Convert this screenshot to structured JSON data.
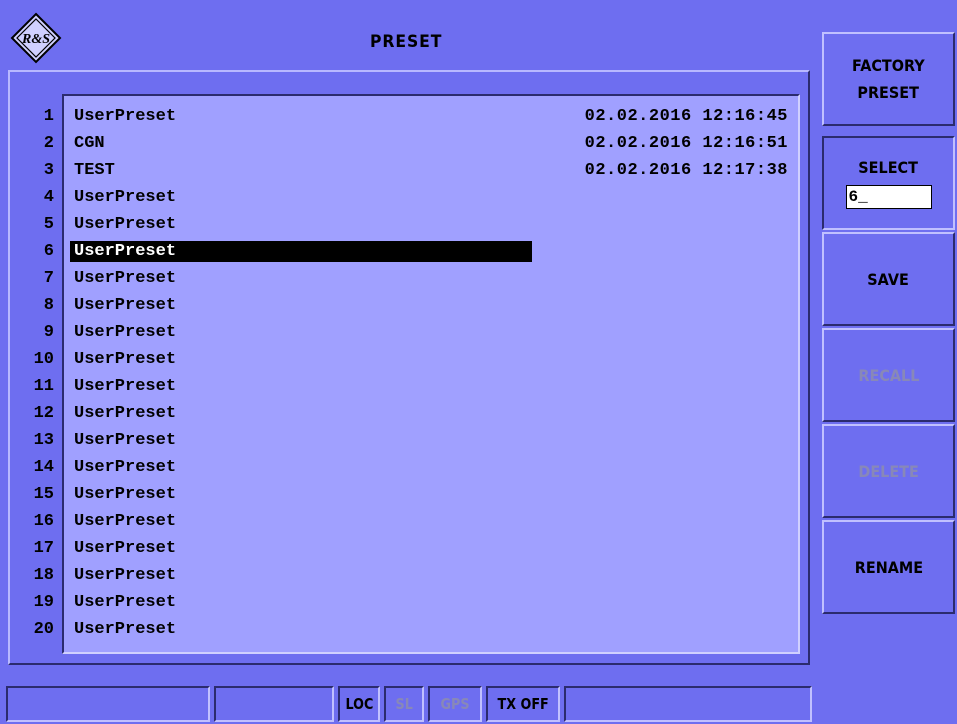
{
  "header": {
    "title": "PRESET",
    "logo_text": "R&S"
  },
  "presets": [
    {
      "num": "1",
      "name": "UserPreset",
      "date": "02.02.2016 12:16:45"
    },
    {
      "num": "2",
      "name": "CGN",
      "date": "02.02.2016 12:16:51"
    },
    {
      "num": "3",
      "name": "TEST",
      "date": "02.02.2016 12:17:38"
    },
    {
      "num": "4",
      "name": "UserPreset",
      "date": ""
    },
    {
      "num": "5",
      "name": "UserPreset",
      "date": ""
    },
    {
      "num": "6",
      "name": "UserPreset",
      "date": ""
    },
    {
      "num": "7",
      "name": "UserPreset",
      "date": ""
    },
    {
      "num": "8",
      "name": "UserPreset",
      "date": ""
    },
    {
      "num": "9",
      "name": "UserPreset",
      "date": ""
    },
    {
      "num": "10",
      "name": "UserPreset",
      "date": ""
    },
    {
      "num": "11",
      "name": "UserPreset",
      "date": ""
    },
    {
      "num": "12",
      "name": "UserPreset",
      "date": ""
    },
    {
      "num": "13",
      "name": "UserPreset",
      "date": ""
    },
    {
      "num": "14",
      "name": "UserPreset",
      "date": ""
    },
    {
      "num": "15",
      "name": "UserPreset",
      "date": ""
    },
    {
      "num": "16",
      "name": "UserPreset",
      "date": ""
    },
    {
      "num": "17",
      "name": "UserPreset",
      "date": ""
    },
    {
      "num": "18",
      "name": "UserPreset",
      "date": ""
    },
    {
      "num": "19",
      "name": "UserPreset",
      "date": ""
    },
    {
      "num": "20",
      "name": "UserPreset",
      "date": ""
    }
  ],
  "selected_row": 6,
  "softkeys": {
    "factory_preset": {
      "line1": "FACTORY",
      "line2": "PRESET"
    },
    "select": {
      "label": "SELECT",
      "value": "6_"
    },
    "save": "SAVE",
    "recall": "RECALL",
    "delete": "DELETE",
    "rename": "RENAME"
  },
  "status_bar": {
    "loc": "LOC",
    "sl": "SL",
    "gps": "GPS",
    "tx": "TX OFF"
  },
  "colors": {
    "background": "#6e6ef0",
    "list_background": "#a0a0ff",
    "selection": "#000000",
    "disabled_text": "#8888b8"
  }
}
